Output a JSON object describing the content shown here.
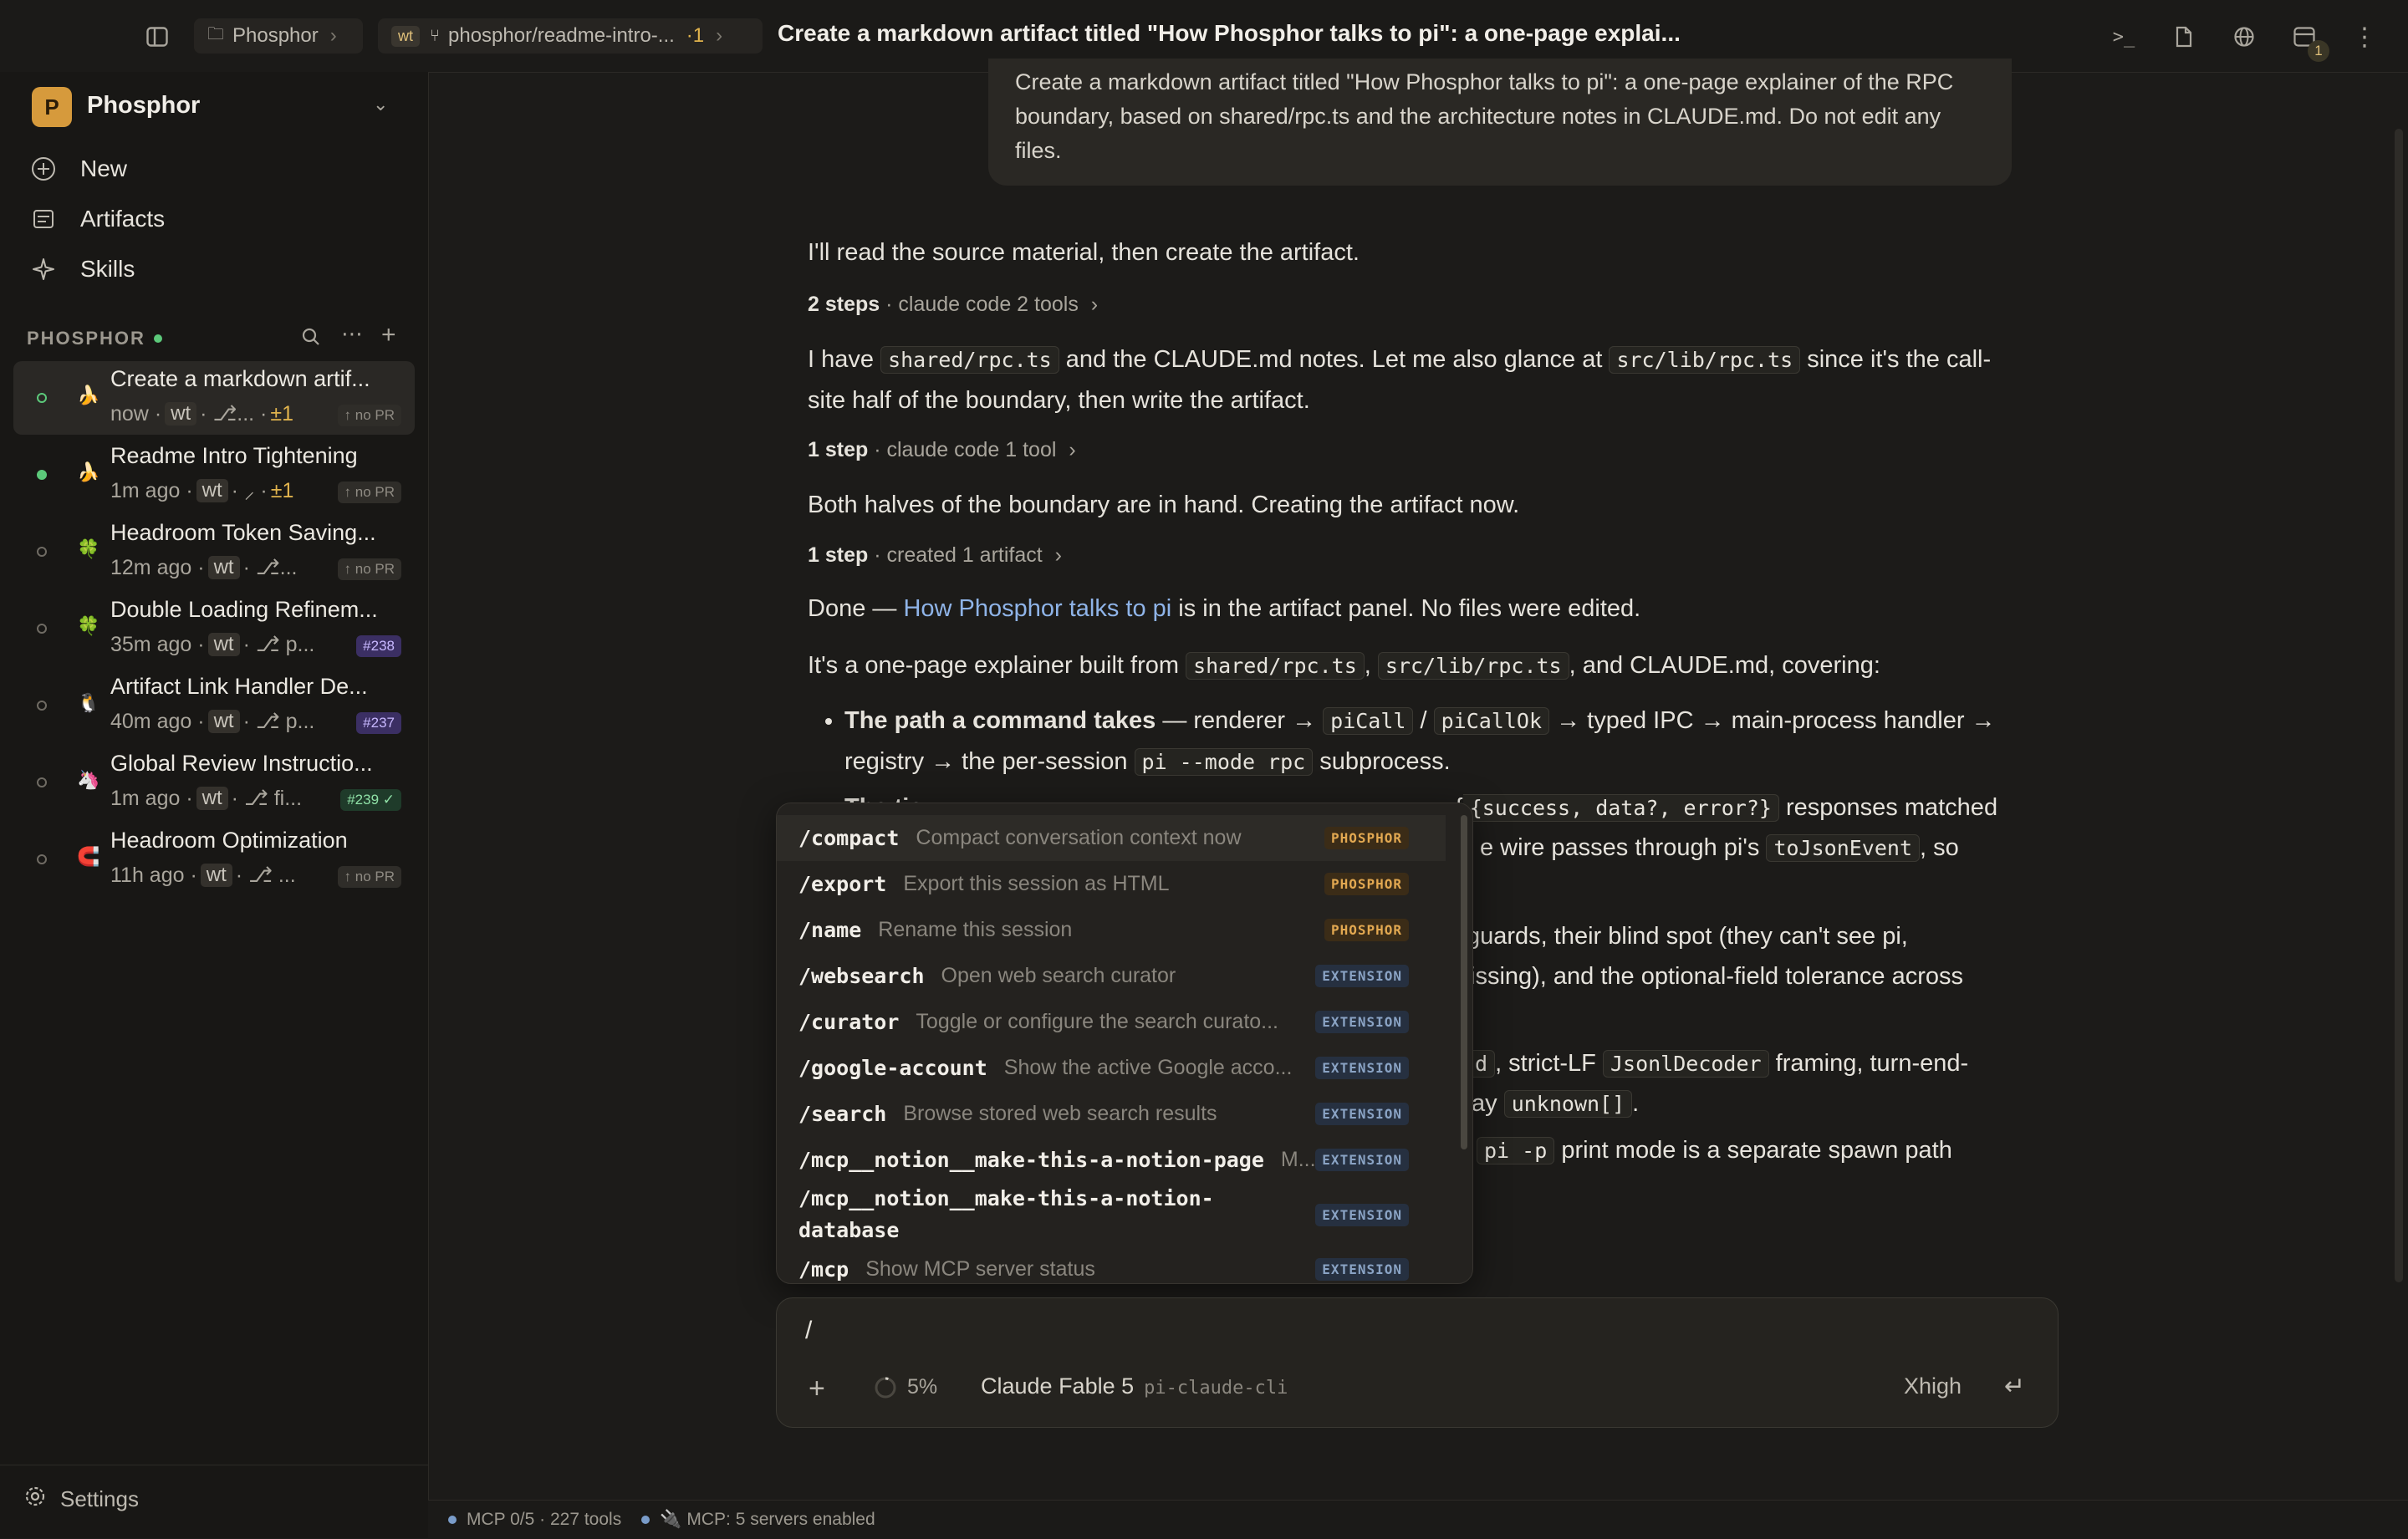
{
  "topbar": {
    "workspace_crumb": "Phosphor",
    "branch_badge": "wt",
    "branch_crumb": "phosphor/readme-intro-...",
    "branch_diff": "·1",
    "title": "Create a markdown artifact titled \"How Phosphor talks to pi\": a one-page explai...",
    "notification_count": "1"
  },
  "sidebar": {
    "avatar_letter": "P",
    "workspace_name": "Phosphor",
    "nav": [
      {
        "label": "New"
      },
      {
        "label": "Artifacts"
      },
      {
        "label": "Skills"
      }
    ],
    "section_label": "PHOSPHOR",
    "sessions": [
      {
        "title": "Create a markdown artif...",
        "time": "now",
        "badge": "wt",
        "branch": "⎇...",
        "diff": "±1",
        "pr": "↑ no PR"
      },
      {
        "title": "Readme Intro Tightening",
        "time": "1m ago",
        "badge": "wt",
        "branch": "⸝",
        "diff": "±1",
        "pr": "↑ no PR"
      },
      {
        "title": "Headroom Token Saving...",
        "time": "12m ago",
        "badge": "wt",
        "branch": "⎇...",
        "diff": "",
        "pr": "↑ no PR"
      },
      {
        "title": "Double Loading Refinem...",
        "time": "35m ago",
        "badge": "wt",
        "branch": "⎇ p...",
        "diff": "",
        "pr": "#238"
      },
      {
        "title": "Artifact Link Handler De...",
        "time": "40m ago",
        "badge": "wt",
        "branch": "⎇ p...",
        "diff": "",
        "pr": "#237"
      },
      {
        "title": "Global Review Instructio...",
        "time": "1m ago",
        "badge": "wt",
        "branch": "⎇ fi...",
        "diff": "",
        "pr": "#239 ✓"
      },
      {
        "title": "Headroom Optimization",
        "time": "11h ago",
        "badge": "wt",
        "branch": "⎇ ...",
        "diff": "",
        "pr": "↑ no PR"
      }
    ],
    "settings_label": "Settings"
  },
  "chat": {
    "prompt": "Create a markdown artifact titled \"How Phosphor talks to pi\": a one-page explainer of the RPC boundary, based on shared/rpc.ts and the architecture notes in CLAUDE.md. Do not edit any files.",
    "msg1": "I'll read the source material, then create the artifact.",
    "steps1_count": "2 steps",
    "steps1_detail": "· claude code 2 tools",
    "msg2_a": "I have",
    "msg2_code1": "shared/rpc.ts",
    "msg2_b": "and the CLAUDE.md notes. Let me also glance at",
    "msg2_code2": "src/lib/rpc.ts",
    "msg2_c": "since it's the call-site half of the boundary, then write the artifact.",
    "steps2_count": "1 step",
    "steps2_detail": "· claude code 1 tool",
    "msg3": "Both halves of the boundary are in hand. Creating the artifact now.",
    "steps3_count": "1 step",
    "steps3_detail": "· created 1 artifact",
    "msg4_a": "Done —",
    "msg4_link": "How Phosphor talks to pi",
    "msg4_b": "is in the artifact panel. No files were edited.",
    "msg5_a": "It's a one-page explainer built from",
    "msg5_code1": "shared/rpc.ts",
    "msg5_code2": "src/lib/rpc.ts",
    "msg5_b": ", and CLAUDE.md, covering:",
    "bullet1_bold": "The path a command takes",
    "bullet1_a": "— renderer →",
    "bullet1_code1": "piCall",
    "bullet1_code2": "piCallOk",
    "bullet1_b": "→ typed IPC → main-process handler → registry → the per-session",
    "bullet1_code3": "pi --mode rpc",
    "bullet1_c": "subprocess.",
    "bullet2_bold": "The tie",
    "bullet2_code1": "{success, data?, error?}",
    "bullet2_a": "responses matched",
    "bullet2_b": "e wire passes through pi's",
    "bullet2_code2": "toJsonEvent",
    "bullet2_c": ", so",
    "frag3a": "guards, their blind spot (they can't see pi,",
    "frag3b": "issing), and the optional-field tolerance across",
    "frag4_code1": "d",
    "frag4_a": ", strict-LF",
    "frag4_code2": "JsonlDecoder",
    "frag4_b": "framing, turn-end-",
    "frag4_c": "ay",
    "frag4_code3": "unknown[]",
    "frag4_d": ".",
    "frag5_code": "pi -p",
    "frag5_a": "print mode is a separate spawn path"
  },
  "slash_menu": {
    "items": [
      {
        "name": "/compact",
        "desc": "Compact conversation context now",
        "tag": "PHOSPHOR"
      },
      {
        "name": "/export",
        "desc": "Export this session as HTML",
        "tag": "PHOSPHOR"
      },
      {
        "name": "/name",
        "desc": "Rename this session",
        "tag": "PHOSPHOR"
      },
      {
        "name": "/websearch",
        "desc": "Open web search curator",
        "tag": "EXTENSION"
      },
      {
        "name": "/curator",
        "desc": "Toggle or configure the search curato...",
        "tag": "EXTENSION"
      },
      {
        "name": "/google-account",
        "desc": "Show the active Google acco...",
        "tag": "EXTENSION"
      },
      {
        "name": "/search",
        "desc": "Browse stored web search results",
        "tag": "EXTENSION"
      },
      {
        "name": "/mcp__notion__make-this-a-notion-page",
        "desc": "M...",
        "tag": "EXTENSION"
      },
      {
        "name": "/mcp__notion__make-this-a-notion-database",
        "desc": "",
        "tag": "EXTENSION"
      },
      {
        "name": "/mcp",
        "desc": "Show MCP server status",
        "tag": "EXTENSION"
      }
    ]
  },
  "composer": {
    "value": "/",
    "context_pct": "5%",
    "model": "Claude Fable 5",
    "provider": "pi-claude-cli",
    "thinking": "Xhigh"
  },
  "statusbar": {
    "mcp_tools": "MCP 0/5 · 227 tools",
    "mcp_servers": "MCP: 5 servers enabled"
  },
  "colors": {
    "background": "#1c1b19",
    "sidebar": "#181715",
    "accent_link": "#8fb4e8",
    "phosphor_tag": "#e2a851",
    "live_dot": "#5cc97a"
  }
}
